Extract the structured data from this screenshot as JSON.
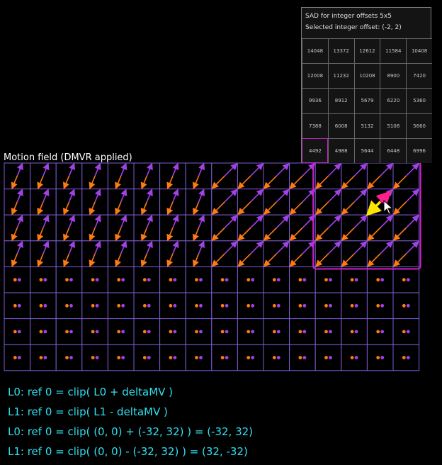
{
  "field": {
    "title": "Motion field (DMVR applied)",
    "cols": 16,
    "rows": 8,
    "applied_rows": 4,
    "highlight_cols": [
      12,
      15
    ],
    "highlight_rows": [
      0,
      3
    ],
    "colors": {
      "grid": "#7c5cd6",
      "l0_arrow": "#a042e6",
      "l1_arrow": "#ff7a12",
      "highlight": "#d01fd0",
      "selected_l0": "#ff1f8f",
      "selected_l1": "#ffe600"
    }
  },
  "sad": {
    "title": "SAD for integer offsets 5x5",
    "selected": "Selected integer offset: (-2, 2)",
    "selected_index": [
      4,
      0
    ],
    "values": [
      [
        "14048",
        "13372",
        "12612",
        "11584",
        "10408"
      ],
      [
        "12008",
        "11232",
        "10208",
        "8900",
        "7420"
      ],
      [
        "9936",
        "8912",
        "5679",
        "6220",
        "5360"
      ],
      [
        "7388",
        "6008",
        "5132",
        "5108",
        "5660"
      ],
      [
        "4492",
        "4988",
        "5644",
        "6448",
        "6996"
      ]
    ]
  },
  "equations": [
    "L0: ref 0 = clip( L0 + deltaMV )",
    "L1: ref 0 = clip( L1 - deltaMV )",
    "L0: ref 0 = clip( (0, 0) + (-32, 32) ) = (-32, 32)",
    "L1: ref 0 = clip( (0, 0) - (-32, 32) ) = (32, -32)"
  ]
}
